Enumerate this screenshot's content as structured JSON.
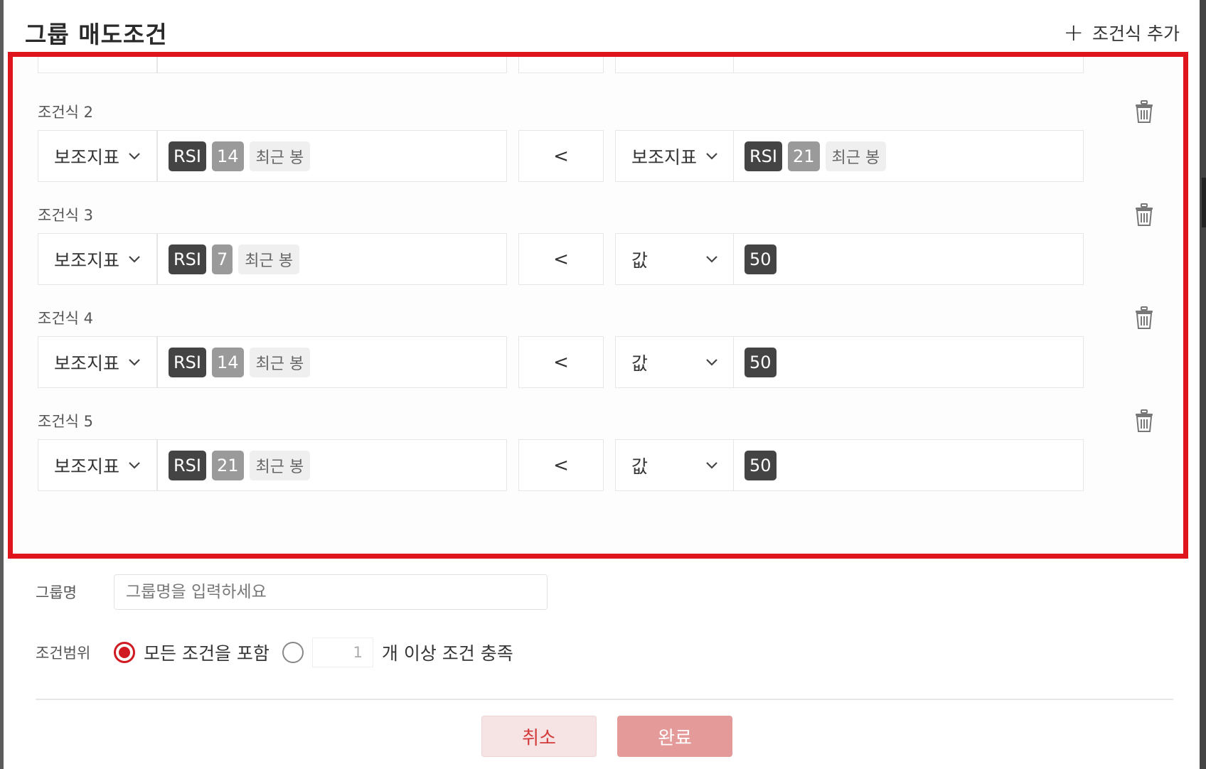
{
  "header": {
    "title": "그룹 매도조건",
    "add_label": "조건식 추가"
  },
  "conditions": [
    {
      "label": "조건식 2",
      "left": {
        "type": "보조지표",
        "tags": [
          "RSI",
          "14",
          "최근 봉"
        ]
      },
      "operator": "<",
      "right": {
        "type": "보조지표",
        "tags": [
          "RSI",
          "21",
          "최근 봉"
        ]
      }
    },
    {
      "label": "조건식 3",
      "left": {
        "type": "보조지표",
        "tags": [
          "RSI",
          "7",
          "최근 봉"
        ]
      },
      "operator": "<",
      "right": {
        "type": "값",
        "tags": [
          "50"
        ]
      }
    },
    {
      "label": "조건식 4",
      "left": {
        "type": "보조지표",
        "tags": [
          "RSI",
          "14",
          "최근 봉"
        ]
      },
      "operator": "<",
      "right": {
        "type": "값",
        "tags": [
          "50"
        ]
      }
    },
    {
      "label": "조건식 5",
      "left": {
        "type": "보조지표",
        "tags": [
          "RSI",
          "21",
          "최근 봉"
        ]
      },
      "operator": "<",
      "right": {
        "type": "값",
        "tags": [
          "50"
        ]
      }
    }
  ],
  "group_name": {
    "label": "그룹명",
    "placeholder": "그룹명을 입력하세요"
  },
  "scope": {
    "label": "조건범위",
    "option_all": "모든 조건을 포함",
    "count_value": "1",
    "option_count_suffix": "개 이상 조건 충족"
  },
  "buttons": {
    "cancel": "취소",
    "done": "완료"
  },
  "colors": {
    "accent": "#e0141c",
    "tag_dark": "#444444",
    "tag_gray": "#9a9a9a"
  }
}
